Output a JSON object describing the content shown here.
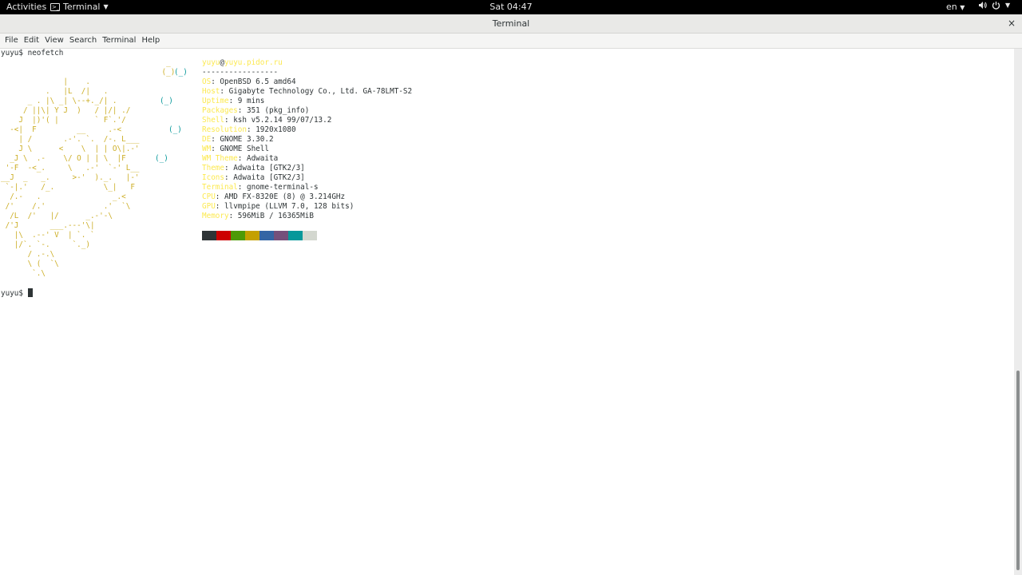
{
  "topbar": {
    "activities": "Activities",
    "app_name": "Terminal",
    "clock": "Sat 04:47",
    "language": "en"
  },
  "window": {
    "title": "Terminal",
    "close": "×"
  },
  "menu": [
    "File",
    "Edit",
    "View",
    "Search",
    "Terminal",
    "Help"
  ],
  "terminal": {
    "prompt": "yuyu$ ",
    "command": "neofetch",
    "user": "yuyu",
    "at": "@",
    "host": "yuyu.pidor.ru",
    "separator": "-----------------",
    "info": [
      {
        "key": "OS",
        "value": "OpenBSD 6.5 amd64"
      },
      {
        "key": "Host",
        "value": "Gigabyte Technology Co., Ltd. GA-78LMT-S2"
      },
      {
        "key": "Uptime",
        "value": "9 mins"
      },
      {
        "key": "Packages",
        "value": "351 (pkg_info)"
      },
      {
        "key": "Shell",
        "value": "ksh v5.2.14 99/07/13.2"
      },
      {
        "key": "Resolution",
        "value": "1920x1080"
      },
      {
        "key": "DE",
        "value": "GNOME 3.30.2"
      },
      {
        "key": "WM",
        "value": "GNOME Shell"
      },
      {
        "key": "WM Theme",
        "value": "Adwaita"
      },
      {
        "key": "Theme",
        "value": "Adwaita [GTK2/3]"
      },
      {
        "key": "Icons",
        "value": "Adwaita [GTK2/3]"
      },
      {
        "key": "Terminal",
        "value": "gnome-terminal-s"
      },
      {
        "key": "CPU",
        "value": "AMD FX-8320E (8) @ 3.214GHz"
      },
      {
        "key": "GPU",
        "value": "llvmpipe (LLVM 7.0, 128 bits)"
      },
      {
        "key": "Memory",
        "value": "596MiB / 16365MiB"
      }
    ],
    "palette": [
      "#2e3436",
      "#cc0000",
      "#4e9a06",
      "#c4a000",
      "#3465a4",
      "#75507b",
      "#06989a",
      "#d3d7cf"
    ]
  },
  "ascii_art": {
    "y0": "                                     _",
    "y1": "                                    (_)",
    "y2": "              |    .",
    "y3": "          .   |L  /|   .",
    "y4": "      _ . |\\ _| \\--+._/| .",
    "y5": "     / ||\\| Y J  )   / |/| ./",
    "y6": "    J  |)'( |        ` F`.'/",
    "y7": "  -<|  F         __     .-<",
    "y8": "    | /       .-'. `.  /-. L___",
    "y9": "    J \\      <    \\  | | O\\|.-'",
    "y10": "  _J \\  .-    \\/ O | | \\  |F",
    "y11": " '-F  -<_.     \\   .-'  `-' L__",
    "y12": "__J  _   _.     >-'  )._.   |-'",
    "y13": " `-|.'   /_.           \\_|   F",
    "y14": "  /.-   .                _.<",
    "y15": " /'    /.'             .'  `\\",
    "y16": "  /L  /'   |/      _.-'-\\",
    "y17": " /'J       ___.---'\\|",
    "y18": "   |\\  .--' V  | `. `",
    "y19": "   |/`. `-.     `._)",
    "y20": "      / .-.\\",
    "y21": "      \\ (  `\\",
    "y22": "       `.\\",
    "c1": "(_)",
    "c2": "(_)",
    "c3": "(_)",
    "c4": "(_)"
  },
  "colors": {
    "accent_yellow": "#fce94f",
    "ascii_yellow": "#c4a000",
    "ascii_cyan": "#06989a",
    "ascii_red": "#cc0000"
  }
}
